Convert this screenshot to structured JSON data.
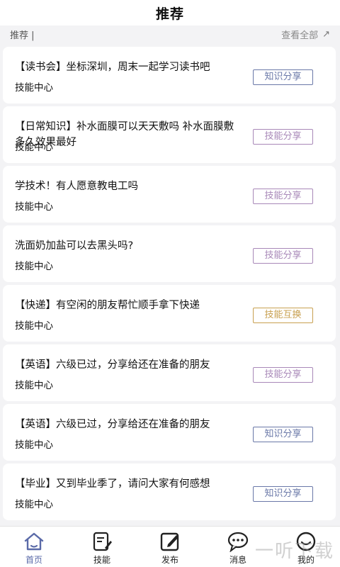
{
  "header": {
    "title": "推荐"
  },
  "subbar": {
    "left_label": "推荐 |",
    "right_label": "查看全部"
  },
  "posts": [
    {
      "title": "【读书会】坐标深圳，周末一起学习读书吧",
      "category": "技能中心",
      "tag": "知识分享",
      "tag_color": "#6a78a8"
    },
    {
      "title": "【日常知识】补水面膜可以天天敷吗 补水面膜敷多久效果最好",
      "category": "技能中心",
      "tag": "技能分享",
      "tag_color": "#a888b8"
    },
    {
      "title": "学技术！有人愿意教电工吗",
      "category": "技能中心",
      "tag": "技能分享",
      "tag_color": "#a888b8"
    },
    {
      "title": "洗面奶加盐可以去黑头吗?",
      "category": "技能中心",
      "tag": "技能分享",
      "tag_color": "#a888b8"
    },
    {
      "title": "【快递】有空闲的朋友帮忙顺手拿下快递",
      "category": "技能中心",
      "tag": "技能互换",
      "tag_color": "#c8a050"
    },
    {
      "title": "【英语】六级已过，分享给还在准备的朋友",
      "category": "技能中心",
      "tag": "技能分享",
      "tag_color": "#a888b8"
    },
    {
      "title": "【英语】六级已过，分享给还在准备的朋友",
      "category": "技能中心",
      "tag": "知识分享",
      "tag_color": "#6a78a8"
    },
    {
      "title": "【毕业】又到毕业季了，请问大家有何感想",
      "category": "技能中心",
      "tag": "知识分享",
      "tag_color": "#6a78a8"
    }
  ],
  "tabbar": {
    "tabs": [
      {
        "label": "首页",
        "icon": "home-icon",
        "active": true
      },
      {
        "label": "技能",
        "icon": "skill-edit-icon",
        "active": false
      },
      {
        "label": "发布",
        "icon": "publish-icon",
        "active": false
      },
      {
        "label": "消息",
        "icon": "message-icon",
        "active": false
      },
      {
        "label": "我的",
        "icon": "profile-icon",
        "active": false
      }
    ]
  },
  "watermark": "一听下载"
}
